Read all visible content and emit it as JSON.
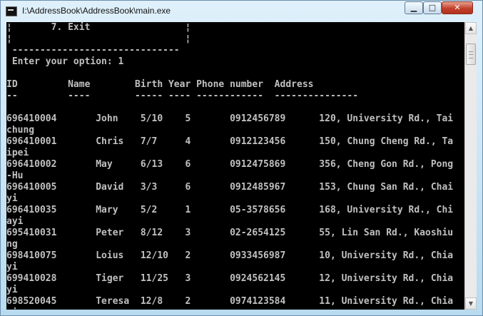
{
  "window": {
    "title": "I:\\AddressBook\\AddressBook\\main.exe",
    "controls": {
      "minimize": "▁",
      "maximize": "□",
      "close": "✕"
    }
  },
  "console": {
    "lines": [
      "¦       7. Exit                 ¦",
      "¦                               ¦",
      " ------------------------------",
      " Enter your option: 1",
      "",
      "ID         Name        Birth Year Phone number  Address",
      "--         ----        ----- ---- ------------  ---------------",
      "",
      "696410004       John    5/10    5       0912456789      120, University Rd., Tai",
      "chung",
      "696410001       Chris   7/7     4       0912123456      150, Chung Cheng Rd., Ta",
      "ipei",
      "696410002       May     6/13    6       0912475869      356, Cheng Gon Rd., Pong",
      "-Hu",
      "696410005       David   3/3     6       0912485967      153, Chung San Rd., Chai",
      "yi",
      "696410035       Mary    5/2     1       05-3578656      168, University Rd., Chi",
      "ayi",
      "695410031       Peter   8/12    3       02-2654125      55, Lin San Rd., Kaoshiu",
      "ng",
      "698410075       Loius   12/10   2       0933456987      10, University Rd., Chia",
      "yi",
      "699410028       Tiger   11/25   3       0924562145      12, University Rd., Chia",
      "yi",
      "698520045       Teresa  12/8    2       0974123584      11, University Rd., Chia",
      "yi"
    ]
  },
  "scrollbar": {
    "up_arrow": "▲",
    "down_arrow": "▼"
  }
}
